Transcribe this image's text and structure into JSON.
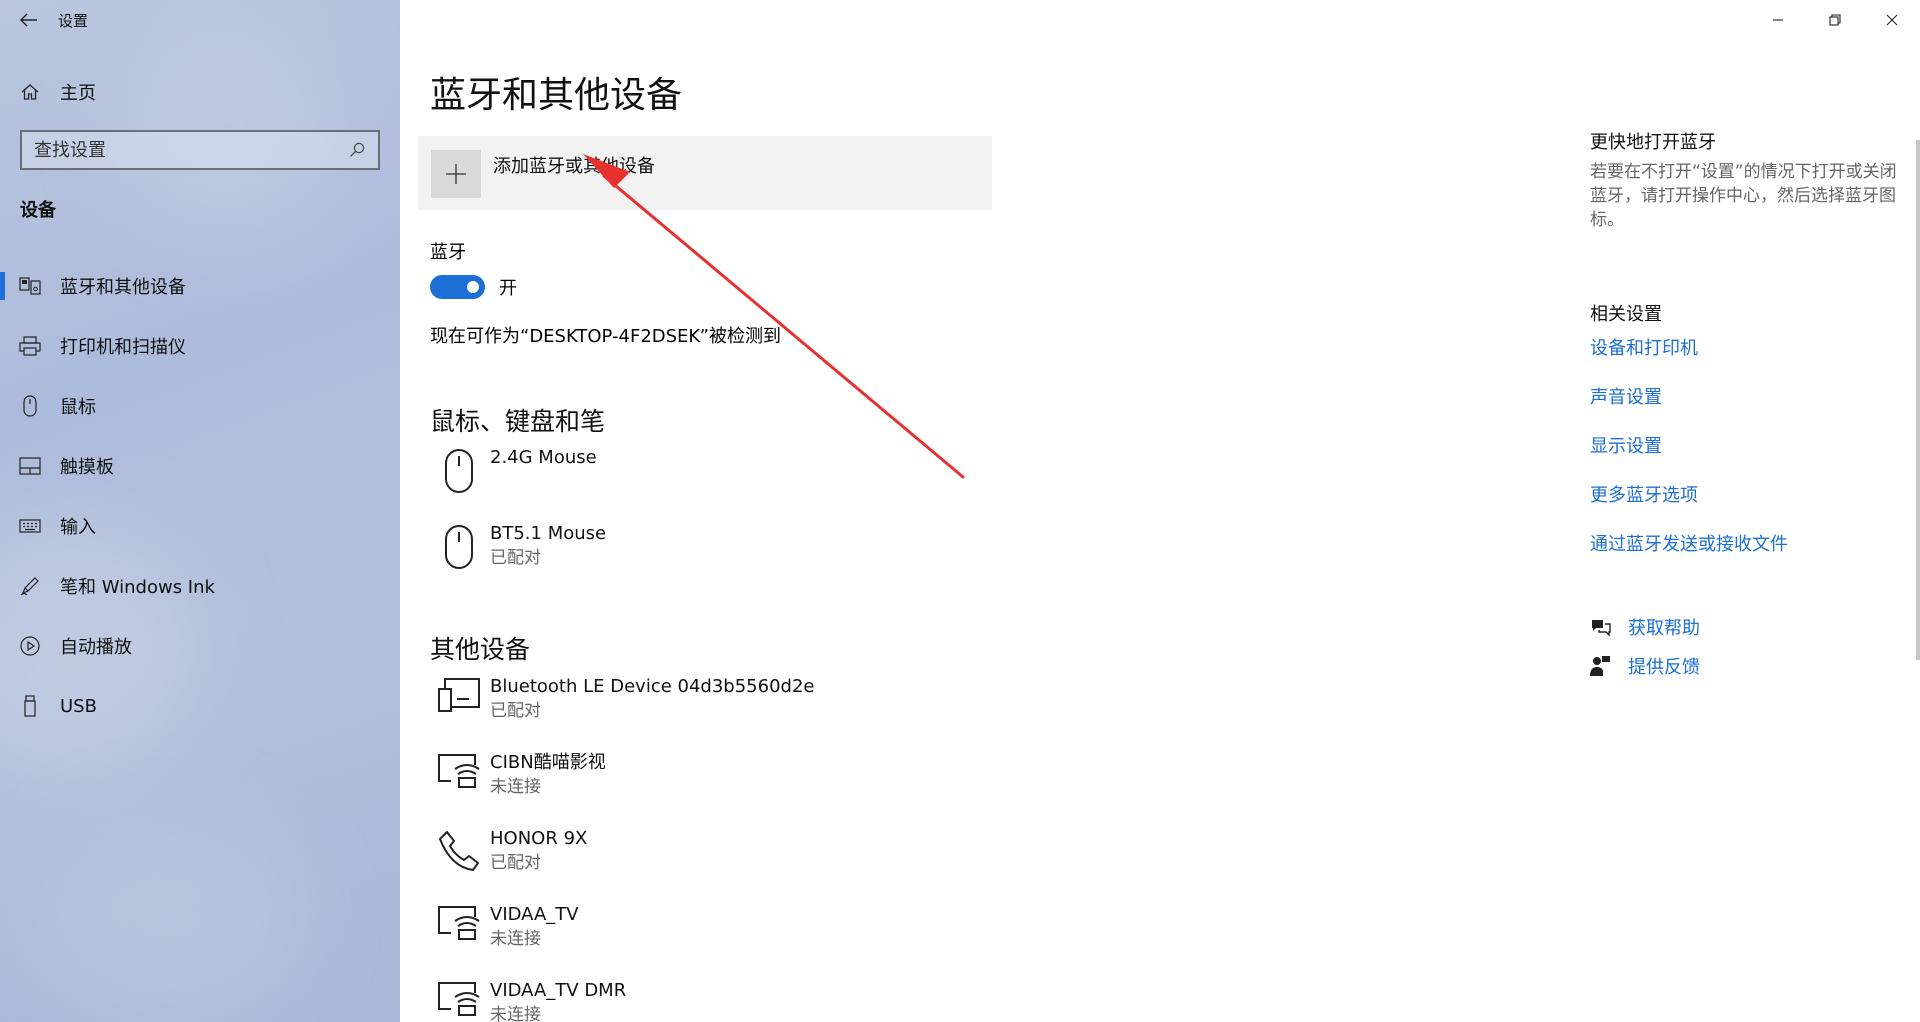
{
  "window": {
    "title": "设置",
    "minimize": "minimize",
    "maximize": "maximize",
    "close": "close"
  },
  "sidebar": {
    "home_label": "主页",
    "search_placeholder": "查找设置",
    "section_title": "设备",
    "items": [
      {
        "label": "蓝牙和其他设备",
        "icon": "bluetooth-devices-icon",
        "active": true
      },
      {
        "label": "打印机和扫描仪",
        "icon": "printer-icon",
        "active": false
      },
      {
        "label": "鼠标",
        "icon": "mouse-icon",
        "active": false
      },
      {
        "label": "触摸板",
        "icon": "touchpad-icon",
        "active": false
      },
      {
        "label": "输入",
        "icon": "keyboard-icon",
        "active": false
      },
      {
        "label": "笔和 Windows Ink",
        "icon": "pen-icon",
        "active": false
      },
      {
        "label": "自动播放",
        "icon": "autoplay-icon",
        "active": false
      },
      {
        "label": "USB",
        "icon": "usb-icon",
        "active": false
      }
    ]
  },
  "main": {
    "title": "蓝牙和其他设备",
    "add_device_label": "添加蓝牙或其他设备",
    "bluetooth_label": "蓝牙",
    "toggle_state": "开",
    "discoverable_text": "现在可作为“DESKTOP-4F2DSEK”被检测到",
    "mouse_group": {
      "title": "鼠标、键盘和笔",
      "devices": [
        {
          "name": "2.4G Mouse",
          "status": ""
        },
        {
          "name": "BT5.1 Mouse",
          "status": "已配对"
        }
      ]
    },
    "other_group": {
      "title": "其他设备",
      "devices": [
        {
          "name": "Bluetooth LE Device 04d3b5560d2e",
          "status": "已配对",
          "icon": "device-icon"
        },
        {
          "name": "CIBN酷喵影视",
          "status": "未连接",
          "icon": "media-device-icon"
        },
        {
          "name": "HONOR 9X",
          "status": "已配对",
          "icon": "phone-icon"
        },
        {
          "name": "VIDAA_TV",
          "status": "未连接",
          "icon": "media-device-icon"
        },
        {
          "name": "VIDAA_TV DMR",
          "status": "未连接",
          "icon": "media-device-icon"
        }
      ]
    }
  },
  "right_panel": {
    "quick_title": "更快地打开蓝牙",
    "quick_text": "若要在不打开“设置”的情况下打开或关闭蓝牙，请打开操作中心，然后选择蓝牙图标。",
    "related_title": "相关设置",
    "links": [
      "设备和打印机",
      "声音设置",
      "显示设置",
      "更多蓝牙选项",
      "通过蓝牙发送或接收文件"
    ],
    "help_label": "获取帮助",
    "feedback_label": "提供反馈"
  },
  "colors": {
    "accent": "#1b6fd6",
    "annotation": "#e8302f"
  }
}
